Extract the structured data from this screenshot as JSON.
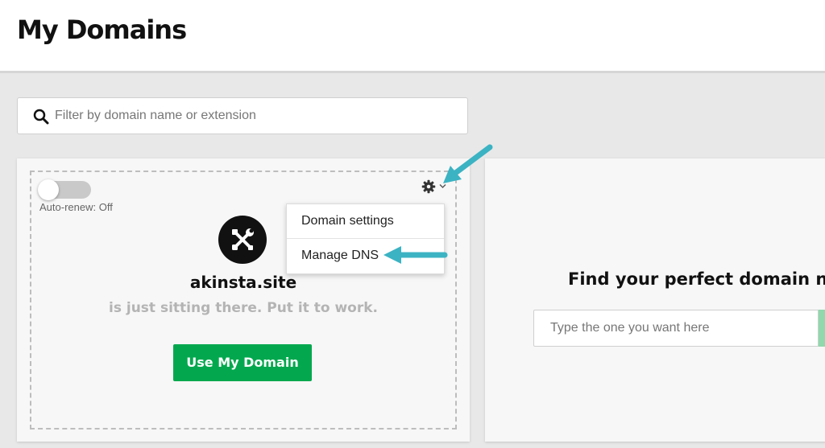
{
  "header": {
    "title": "My Domains"
  },
  "filter": {
    "placeholder": "Filter by domain name or extension",
    "icon": "search-icon"
  },
  "domain_card": {
    "auto_renew_label": "Auto-renew: Off",
    "auto_renew_on": false,
    "domain": "akinsta.site",
    "tagline": "is just sitting there. Put it to work.",
    "use_button": "Use My Domain",
    "menu": {
      "items": [
        "Domain settings",
        "Manage DNS"
      ]
    }
  },
  "search_card": {
    "title": "Find your perfect domain na",
    "placeholder": "Type the one you want here"
  },
  "colors": {
    "accent_green": "#03a84e",
    "annotation_arrow": "#3bb3c3",
    "page_bg": "#e8e8e8"
  }
}
